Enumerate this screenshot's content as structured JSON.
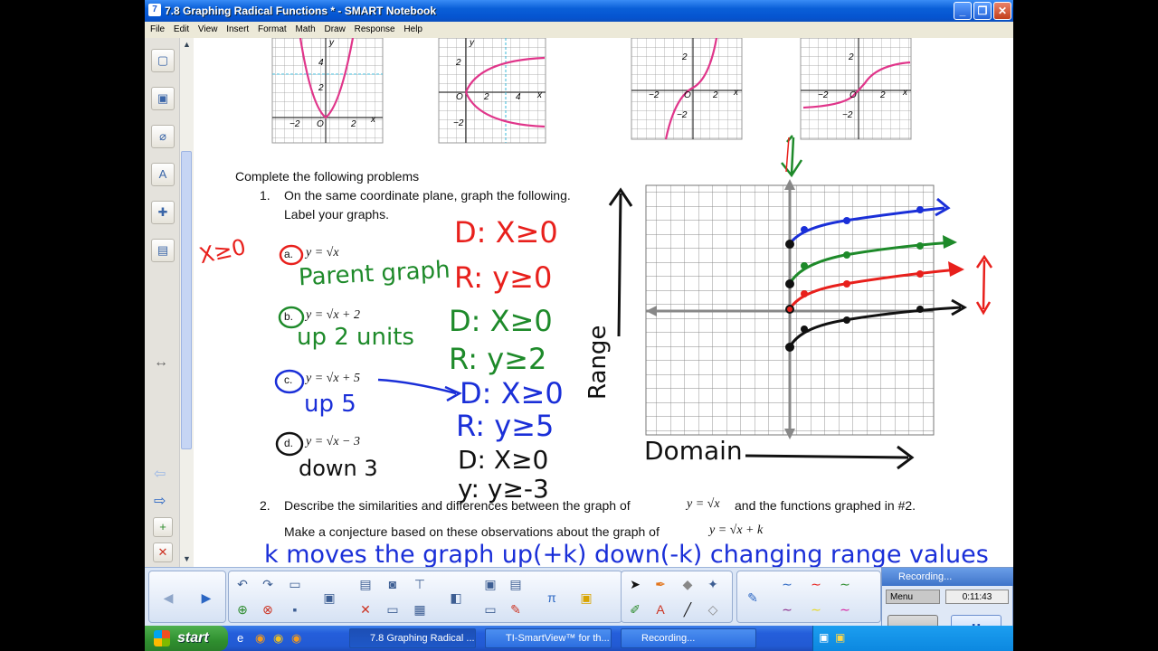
{
  "window": {
    "title": "7.8 Graphing Radical Functions * - SMART Notebook",
    "buttons": {
      "minimize": "_",
      "restore": "❐",
      "close": "✕"
    }
  },
  "menu": [
    "File",
    "Edit",
    "View",
    "Insert",
    "Format",
    "Math",
    "Draw",
    "Response",
    "Help"
  ],
  "page": {
    "intro": "Complete the following problems",
    "q1_num": "1.",
    "q1_line1": "On the same coordinate plane, graph the following.",
    "q1_line2": "Label your graphs.",
    "items": [
      {
        "letter": "a.",
        "eq": "y = √x"
      },
      {
        "letter": "b.",
        "eq": "y = √x + 2"
      },
      {
        "letter": "c.",
        "eq": "y = √x + 5"
      },
      {
        "letter": "d.",
        "eq": "y = √x − 3"
      }
    ],
    "q2_num": "2.",
    "q2_line1a": "Describe the similarities and differences between the graph of",
    "q2_line1eq": "y = √x",
    "q2_line1b": "and the functions graphed in #2.",
    "q2_line2a": "Make a conjecture based on these observations about the graph of",
    "q2_line2eq": "y = √x + k",
    "thumb_labels": {
      "g1": [
        "4",
        "2",
        "−2",
        "O",
        "2",
        "x",
        "y"
      ],
      "g2": [
        "2",
        "O",
        "2",
        "4",
        "−2",
        "x",
        "y"
      ],
      "g3": [
        "2",
        "−2",
        "O",
        "2",
        "x",
        "−2"
      ],
      "g4": [
        "2",
        "−2",
        "O",
        "2",
        "x",
        "−2"
      ]
    }
  },
  "annotations": {
    "x_ge_0": "X≥0",
    "a_note": "Parent graph",
    "a_domain": "D: X≥0",
    "a_range": "R: y≥0",
    "b_note": "up 2 units",
    "b_domain": "D: X≥0",
    "b_range": "R: y≥2",
    "c_note": "up 5",
    "c_domain": "D: X≥0",
    "c_range": "R: y≥5",
    "d_note": "down 3",
    "d_domain": "D: X≥0",
    "d_range": "y: y≥-3",
    "range_label": "Range",
    "domain_label": "Domain",
    "bottom_note": "k moves the graph up(+k) down(-k) changing range values"
  },
  "colors": {
    "red": "#e8201c",
    "green": "#1e8a2a",
    "blue": "#1a2fd8",
    "black": "#111111",
    "pink": "#e0358a"
  },
  "recording": {
    "title": "Recording...",
    "menu": "Menu",
    "time": "0:11:43"
  },
  "taskbar": {
    "start": "start",
    "tasks": [
      "7.8 Graphing Radical ...",
      "TI-SmartView™ for th...",
      "Recording..."
    ]
  },
  "icons": [
    "new-page-icon",
    "screen-capture-icon",
    "attachment-icon",
    "properties-icon",
    "addon-icon",
    "gallery-icon",
    "undo-icon",
    "redo-icon",
    "pointer-icon",
    "pen-icon",
    "eraser-icon",
    "line-icon",
    "text-icon",
    "record-icon",
    "pause-icon"
  ]
}
